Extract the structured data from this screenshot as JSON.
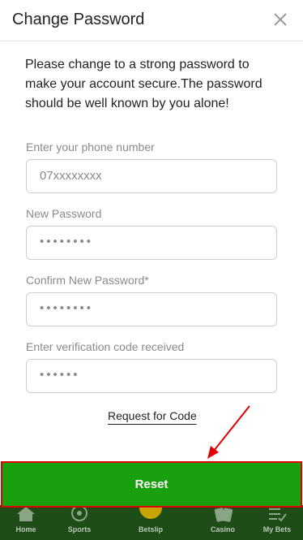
{
  "modal": {
    "title": "Change Password",
    "intro": "Please change to a strong password to make your account secure.The password should be well known by you alone!"
  },
  "form": {
    "phone": {
      "label": "Enter your phone number",
      "placeholder": "07xxxxxxxx"
    },
    "new_password": {
      "label": "New Password",
      "value": "••••••••"
    },
    "confirm_password": {
      "label": "Confirm New Password*",
      "value": "••••••••"
    },
    "verification": {
      "label": "Enter verification code received",
      "value": "••••••"
    },
    "request_code_label": "Request for Code"
  },
  "reset_label": "Reset",
  "bottom_nav": {
    "items": [
      {
        "label": "Home",
        "icon": "home-icon"
      },
      {
        "label": "Sports",
        "icon": "football-icon"
      },
      {
        "label": "Betslip",
        "icon": "betslip-icon"
      },
      {
        "label": "Casino",
        "icon": "cards-icon"
      },
      {
        "label": "My Bets",
        "icon": "my-bets-icon"
      }
    ]
  },
  "colors": {
    "reset_bg": "#19a00f",
    "highlight": "#e00000",
    "nav_bg": "#1e4d18"
  }
}
